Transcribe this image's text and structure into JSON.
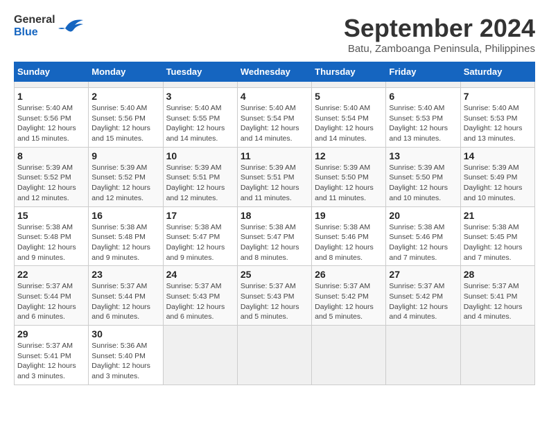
{
  "header": {
    "logo_general": "General",
    "logo_blue": "Blue",
    "month_title": "September 2024",
    "location": "Batu, Zamboanga Peninsula, Philippines"
  },
  "calendar": {
    "days_of_week": [
      "Sunday",
      "Monday",
      "Tuesday",
      "Wednesday",
      "Thursday",
      "Friday",
      "Saturday"
    ],
    "weeks": [
      [
        {
          "day": "",
          "empty": true
        },
        {
          "day": "",
          "empty": true
        },
        {
          "day": "",
          "empty": true
        },
        {
          "day": "",
          "empty": true
        },
        {
          "day": "",
          "empty": true
        },
        {
          "day": "",
          "empty": true
        },
        {
          "day": "",
          "empty": true
        }
      ],
      [
        {
          "day": "1",
          "sunrise": "5:40 AM",
          "sunset": "5:56 PM",
          "daylight": "12 hours and 15 minutes."
        },
        {
          "day": "2",
          "sunrise": "5:40 AM",
          "sunset": "5:56 PM",
          "daylight": "12 hours and 15 minutes."
        },
        {
          "day": "3",
          "sunrise": "5:40 AM",
          "sunset": "5:55 PM",
          "daylight": "12 hours and 14 minutes."
        },
        {
          "day": "4",
          "sunrise": "5:40 AM",
          "sunset": "5:54 PM",
          "daylight": "12 hours and 14 minutes."
        },
        {
          "day": "5",
          "sunrise": "5:40 AM",
          "sunset": "5:54 PM",
          "daylight": "12 hours and 14 minutes."
        },
        {
          "day": "6",
          "sunrise": "5:40 AM",
          "sunset": "5:53 PM",
          "daylight": "12 hours and 13 minutes."
        },
        {
          "day": "7",
          "sunrise": "5:40 AM",
          "sunset": "5:53 PM",
          "daylight": "12 hours and 13 minutes."
        }
      ],
      [
        {
          "day": "8",
          "sunrise": "5:39 AM",
          "sunset": "5:52 PM",
          "daylight": "12 hours and 12 minutes."
        },
        {
          "day": "9",
          "sunrise": "5:39 AM",
          "sunset": "5:52 PM",
          "daylight": "12 hours and 12 minutes."
        },
        {
          "day": "10",
          "sunrise": "5:39 AM",
          "sunset": "5:51 PM",
          "daylight": "12 hours and 12 minutes."
        },
        {
          "day": "11",
          "sunrise": "5:39 AM",
          "sunset": "5:51 PM",
          "daylight": "12 hours and 11 minutes."
        },
        {
          "day": "12",
          "sunrise": "5:39 AM",
          "sunset": "5:50 PM",
          "daylight": "12 hours and 11 minutes."
        },
        {
          "day": "13",
          "sunrise": "5:39 AM",
          "sunset": "5:50 PM",
          "daylight": "12 hours and 10 minutes."
        },
        {
          "day": "14",
          "sunrise": "5:39 AM",
          "sunset": "5:49 PM",
          "daylight": "12 hours and 10 minutes."
        }
      ],
      [
        {
          "day": "15",
          "sunrise": "5:38 AM",
          "sunset": "5:48 PM",
          "daylight": "12 hours and 9 minutes."
        },
        {
          "day": "16",
          "sunrise": "5:38 AM",
          "sunset": "5:48 PM",
          "daylight": "12 hours and 9 minutes."
        },
        {
          "day": "17",
          "sunrise": "5:38 AM",
          "sunset": "5:47 PM",
          "daylight": "12 hours and 9 minutes."
        },
        {
          "day": "18",
          "sunrise": "5:38 AM",
          "sunset": "5:47 PM",
          "daylight": "12 hours and 8 minutes."
        },
        {
          "day": "19",
          "sunrise": "5:38 AM",
          "sunset": "5:46 PM",
          "daylight": "12 hours and 8 minutes."
        },
        {
          "day": "20",
          "sunrise": "5:38 AM",
          "sunset": "5:46 PM",
          "daylight": "12 hours and 7 minutes."
        },
        {
          "day": "21",
          "sunrise": "5:38 AM",
          "sunset": "5:45 PM",
          "daylight": "12 hours and 7 minutes."
        }
      ],
      [
        {
          "day": "22",
          "sunrise": "5:37 AM",
          "sunset": "5:44 PM",
          "daylight": "12 hours and 6 minutes."
        },
        {
          "day": "23",
          "sunrise": "5:37 AM",
          "sunset": "5:44 PM",
          "daylight": "12 hours and 6 minutes."
        },
        {
          "day": "24",
          "sunrise": "5:37 AM",
          "sunset": "5:43 PM",
          "daylight": "12 hours and 6 minutes."
        },
        {
          "day": "25",
          "sunrise": "5:37 AM",
          "sunset": "5:43 PM",
          "daylight": "12 hours and 5 minutes."
        },
        {
          "day": "26",
          "sunrise": "5:37 AM",
          "sunset": "5:42 PM",
          "daylight": "12 hours and 5 minutes."
        },
        {
          "day": "27",
          "sunrise": "5:37 AM",
          "sunset": "5:42 PM",
          "daylight": "12 hours and 4 minutes."
        },
        {
          "day": "28",
          "sunrise": "5:37 AM",
          "sunset": "5:41 PM",
          "daylight": "12 hours and 4 minutes."
        }
      ],
      [
        {
          "day": "29",
          "sunrise": "5:37 AM",
          "sunset": "5:41 PM",
          "daylight": "12 hours and 3 minutes."
        },
        {
          "day": "30",
          "sunrise": "5:36 AM",
          "sunset": "5:40 PM",
          "daylight": "12 hours and 3 minutes."
        },
        {
          "day": "",
          "empty": true
        },
        {
          "day": "",
          "empty": true
        },
        {
          "day": "",
          "empty": true
        },
        {
          "day": "",
          "empty": true
        },
        {
          "day": "",
          "empty": true
        }
      ]
    ],
    "labels": {
      "sunrise": "Sunrise:",
      "sunset": "Sunset:",
      "daylight": "Daylight:"
    }
  }
}
